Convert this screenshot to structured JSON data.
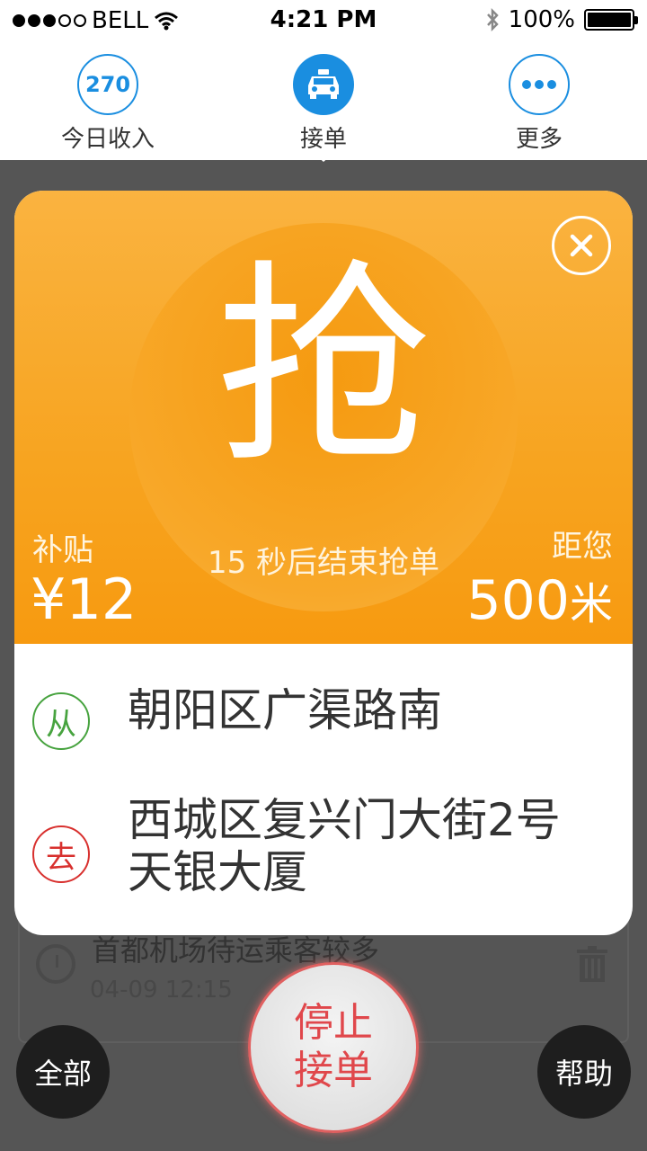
{
  "status_bar": {
    "carrier": "BELL",
    "time": "4:21 PM",
    "battery": "100%"
  },
  "nav": {
    "income": {
      "value": "270",
      "label": "今日收入"
    },
    "accept": {
      "label": "接单",
      "icon": "taxi-icon"
    },
    "more": {
      "label": "更多",
      "icon": "more-dots-icon"
    }
  },
  "background_order": {
    "title": "首都机场待运乘客较多",
    "time": "04-09 12:15"
  },
  "popup": {
    "grab_char": "抢",
    "countdown": "15 秒后结束抢单",
    "subsidy_label": "补贴",
    "subsidy_value": "¥12",
    "distance_label": "距您",
    "distance_value": "500",
    "distance_unit": "米",
    "from_tag": "从",
    "from_address": "朝阳区广渠路南",
    "to_tag": "去",
    "to_address_line1": "西城区复兴门大街2号",
    "to_address_line2": "天银大厦"
  },
  "buttons": {
    "all": "全部",
    "help": "帮助",
    "stop_line1": "停止",
    "stop_line2": "接单"
  },
  "colors": {
    "accent_blue": "#1a8ee0",
    "orange": "#f7a420",
    "from_green": "#47a33f",
    "to_red": "#d8302e"
  }
}
